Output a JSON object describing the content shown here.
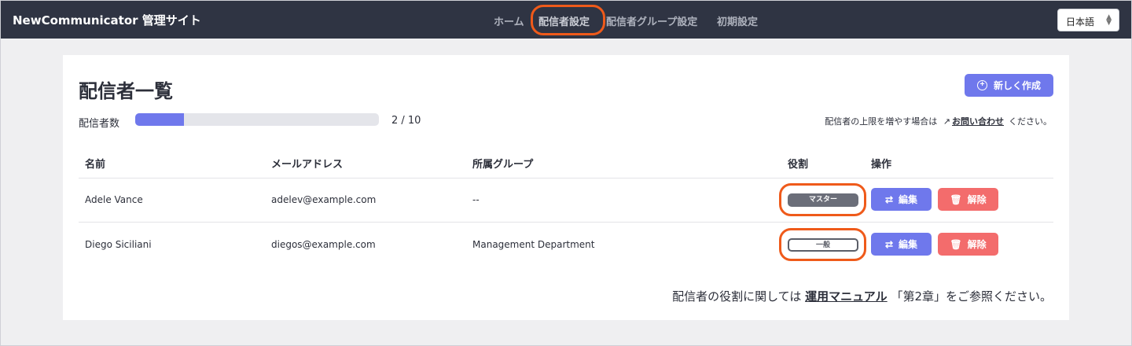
{
  "app": {
    "brand": "NewCommunicator 管理サイト",
    "nav": [
      {
        "label": "ホーム"
      },
      {
        "label": "配信者設定"
      },
      {
        "label": "配信者グループ設定"
      },
      {
        "label": "初期設定"
      }
    ],
    "language": "日本語"
  },
  "page": {
    "title": "配信者一覧",
    "create_label": "新しく作成",
    "count_label": "配信者数",
    "count_value": "2 / 10",
    "usage_fraction": 0.2,
    "limit_note_prefix": "配信者の上限を増やす場合は",
    "limit_note_link": "お問い合わせ",
    "limit_note_suffix": "ください。"
  },
  "table": {
    "headers": {
      "name": "名前",
      "email": "メールアドレス",
      "group": "所属グループ",
      "role": "役割",
      "actions": "操作"
    },
    "rows": [
      {
        "name": "Adele Vance",
        "email": "adelev@example.com",
        "group": "--",
        "role": "マスター",
        "edit": "編集",
        "remove": "解除"
      },
      {
        "name": "Diego Siciliani",
        "email": "diegos@example.com",
        "group": "Management Department",
        "role": "一般",
        "edit": "編集",
        "remove": "解除"
      }
    ]
  },
  "footer": {
    "prefix": "配信者の役割に関しては",
    "link": "運用マニュアル",
    "suffix": "「第2章」をご参照ください。"
  },
  "icons": {
    "create": "plus-circle-icon",
    "external": "external-link-icon",
    "edit": "swap-icon",
    "remove": "trash-icon",
    "lang": "select-chevron-icon"
  },
  "colors": {
    "topbar": "#2f3443",
    "primary": "#6f78ec",
    "danger": "#f36c6c",
    "highlight": "#ef5a1a"
  }
}
